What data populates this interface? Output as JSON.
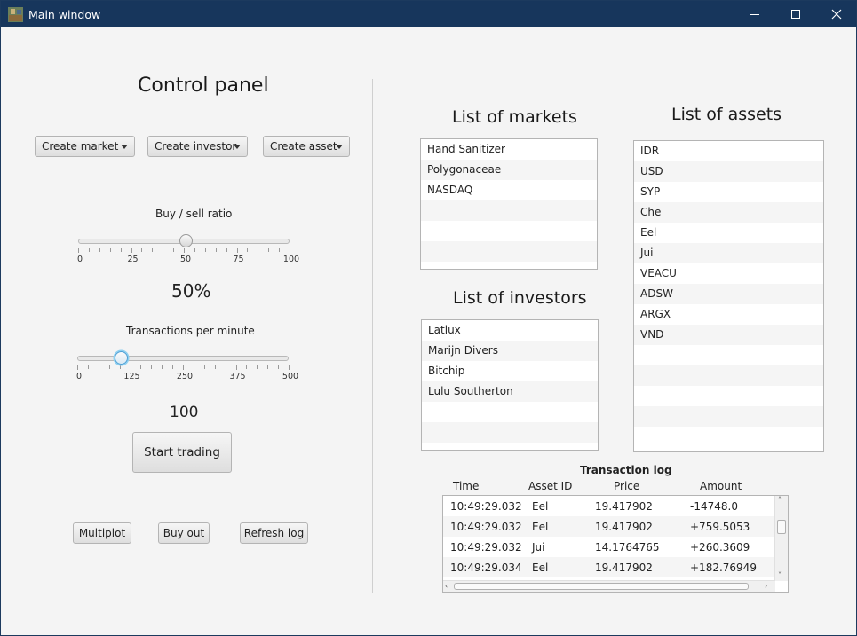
{
  "window": {
    "title": "Main window"
  },
  "control_panel": {
    "title": "Control panel",
    "menus": {
      "create_market": "Create market",
      "create_investor": "Create investor",
      "create_asset": "Create asset"
    },
    "buy_sell": {
      "label": "Buy / sell ratio",
      "ticks": [
        "0",
        "25",
        "50",
        "75",
        "100"
      ],
      "min": 0,
      "max": 100,
      "value": 50,
      "display": "50%"
    },
    "transactions": {
      "label": "Transactions per minute",
      "ticks": [
        "0",
        "125",
        "250",
        "375",
        "500"
      ],
      "min": 0,
      "max": 500,
      "value": 100,
      "display": "100"
    },
    "start_button": "Start trading",
    "multiplot_button": "Multiplot",
    "buyout_button": "Buy out",
    "refresh_button": "Refresh log"
  },
  "markets": {
    "title": "List of markets",
    "items": [
      "Hand Sanitizer",
      "Polygonaceae",
      "NASDAQ",
      "",
      "",
      "",
      ""
    ]
  },
  "investors": {
    "title": "List of investors",
    "items": [
      "Latlux",
      "Marijn Divers",
      "Bitchip",
      "Lulu Southerton",
      "",
      "",
      ""
    ]
  },
  "assets": {
    "title": "List of assets",
    "items": [
      "IDR",
      "USD",
      "SYP",
      "Che",
      "Eel",
      "Jui",
      "VEACU",
      "ADSW",
      "ARGX",
      "VND",
      "",
      "",
      "",
      "",
      ""
    ]
  },
  "log": {
    "title": "Transaction log",
    "columns": [
      "Time",
      "Asset ID",
      "Price",
      "Amount"
    ],
    "rows": [
      [
        "10:49:29.032",
        "Eel",
        "19.417902",
        "-14748.0"
      ],
      [
        "10:49:29.032",
        "Eel",
        "19.417902",
        "+759.5053"
      ],
      [
        "10:49:29.032",
        "Jui",
        "14.1764765",
        "+260.3609"
      ],
      [
        "10:49:29.034",
        "Eel",
        "19.417902",
        "+182.76949"
      ]
    ]
  }
}
